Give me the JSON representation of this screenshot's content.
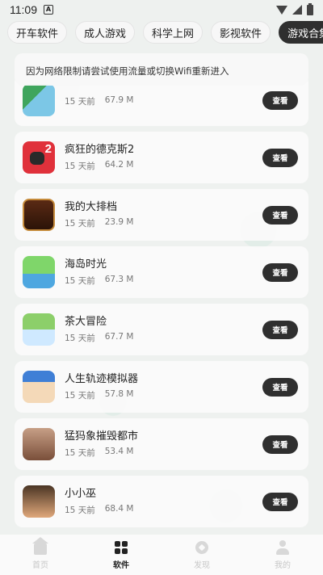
{
  "status_bar": {
    "time": "11:09",
    "notification_letter": "A"
  },
  "tabs": [
    {
      "label": "开车软件",
      "active": false
    },
    {
      "label": "成人游戏",
      "active": false
    },
    {
      "label": "科学上网",
      "active": false
    },
    {
      "label": "影视软件",
      "active": false
    },
    {
      "label": "游戏合集",
      "active": true
    }
  ],
  "notice": "因为网络限制请尝试使用流量或切换Wifi重新进入",
  "apps": [
    {
      "name": "",
      "time": "15 天前",
      "size": "67.9 M",
      "button": "查看",
      "icon": "farm-game-icon"
    },
    {
      "name": "疯狂的德克斯2",
      "time": "15 天前",
      "size": "64.2 M",
      "button": "查看",
      "icon": "dex2-game-icon"
    },
    {
      "name": "我的大排档",
      "time": "15 天前",
      "size": "23.9 M",
      "button": "查看",
      "icon": "food-stall-game-icon"
    },
    {
      "name": "海岛时光",
      "time": "15 天前",
      "size": "67.3 M",
      "button": "查看",
      "icon": "island-game-icon"
    },
    {
      "name": "茶大冒险",
      "time": "15 天前",
      "size": "67.7 M",
      "button": "查看",
      "icon": "tea-adventure-game-icon"
    },
    {
      "name": "人生轨迹模拟器",
      "time": "15 天前",
      "size": "57.8 M",
      "button": "查看",
      "icon": "life-simulator-game-icon"
    },
    {
      "name": "猛犸象摧毁都市",
      "time": "15 天前",
      "size": "53.4 M",
      "button": "查看",
      "icon": "mammoth-game-icon"
    },
    {
      "name": "小小巫",
      "time": "15 天前",
      "size": "68.4 M",
      "button": "查看",
      "icon": "little-witch-game-icon"
    }
  ],
  "bottom_nav": [
    {
      "label": "首页",
      "icon": "home-icon",
      "active": false
    },
    {
      "label": "软件",
      "icon": "apps-grid-icon",
      "active": true
    },
    {
      "label": "发现",
      "icon": "compass-icon",
      "active": false
    },
    {
      "label": "我的",
      "icon": "user-icon",
      "active": false
    }
  ]
}
